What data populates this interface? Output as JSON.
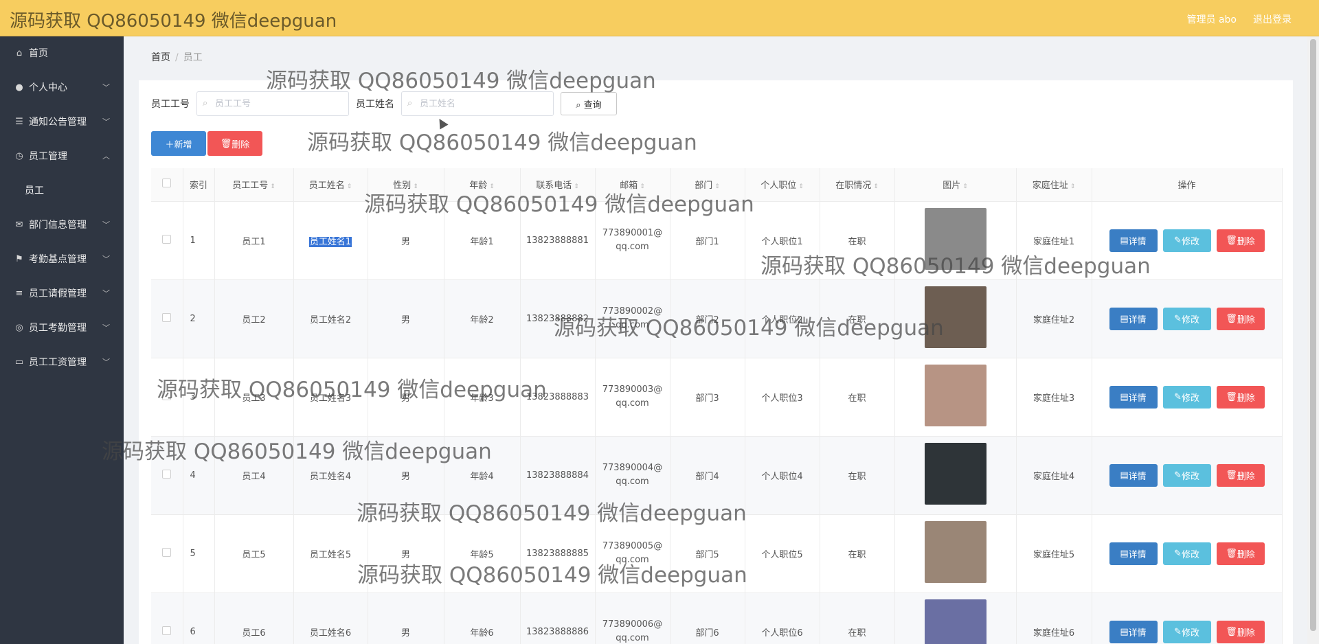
{
  "header": {
    "brand": "源码获取 QQ86050149 微信deepguan",
    "user": "管理员 abo",
    "logout": "退出登录"
  },
  "sidebar": {
    "items": [
      {
        "label": "首页",
        "icon": "home-icon",
        "expandable": false
      },
      {
        "label": "个人中心",
        "icon": "user-icon",
        "expandable": true
      },
      {
        "label": "通知公告管理",
        "icon": "menu-icon",
        "expandable": true
      },
      {
        "label": "员工管理",
        "icon": "clock-icon",
        "expandable": true,
        "expanded": true,
        "children": [
          "员工"
        ]
      },
      {
        "label": "部门信息管理",
        "icon": "mail-icon",
        "expandable": true
      },
      {
        "label": "考勤基点管理",
        "icon": "flag-icon",
        "expandable": true
      },
      {
        "label": "员工请假管理",
        "icon": "sliders-icon",
        "expandable": true
      },
      {
        "label": "员工考勤管理",
        "icon": "circle-icon",
        "expandable": true
      },
      {
        "label": "员工工资管理",
        "icon": "card-icon",
        "expandable": true
      }
    ]
  },
  "breadcrumb": {
    "home": "首页",
    "current": "员工"
  },
  "search": {
    "field1_label": "员工工号",
    "field1_placeholder": "员工工号",
    "field2_label": "员工姓名",
    "field2_placeholder": "员工姓名",
    "query_button": "查询"
  },
  "actions": {
    "add": "新增",
    "delete": "删除"
  },
  "table": {
    "columns": [
      "索引",
      "员工工号",
      "员工姓名",
      "性别",
      "年龄",
      "联系电话",
      "邮箱",
      "部门",
      "个人职位",
      "在职情况",
      "图片",
      "家庭住址",
      "操作"
    ],
    "row_actions": {
      "detail": "详情",
      "edit": "修改",
      "delete": "删除"
    },
    "rows": [
      {
        "index": "1",
        "emp_no": "员工1",
        "name": "员工姓名1",
        "gender": "男",
        "age": "年龄1",
        "phone": "13823888881",
        "email": "773890001@qq.com",
        "dept": "部门1",
        "position": "个人职位1",
        "status": "在职",
        "address": "家庭住址1",
        "photo_color": "#8a8a8a"
      },
      {
        "index": "2",
        "emp_no": "员工2",
        "name": "员工姓名2",
        "gender": "男",
        "age": "年龄2",
        "phone": "13823888882",
        "email": "773890002@qq.com",
        "dept": "部门2",
        "position": "个人职位2",
        "status": "在职",
        "address": "家庭住址2",
        "photo_color": "#6d5e52"
      },
      {
        "index": "3",
        "emp_no": "员工3",
        "name": "员工姓名3",
        "gender": "男",
        "age": "年龄3",
        "phone": "13823888883",
        "email": "773890003@qq.com",
        "dept": "部门3",
        "position": "个人职位3",
        "status": "在职",
        "address": "家庭住址3",
        "photo_color": "#b79484"
      },
      {
        "index": "4",
        "emp_no": "员工4",
        "name": "员工姓名4",
        "gender": "男",
        "age": "年龄4",
        "phone": "13823888884",
        "email": "773890004@qq.com",
        "dept": "部门4",
        "position": "个人职位4",
        "status": "在职",
        "address": "家庭住址4",
        "photo_color": "#2e3438"
      },
      {
        "index": "5",
        "emp_no": "员工5",
        "name": "员工姓名5",
        "gender": "男",
        "age": "年龄5",
        "phone": "13823888885",
        "email": "773890005@qq.com",
        "dept": "部门5",
        "position": "个人职位5",
        "status": "在职",
        "address": "家庭住址5",
        "photo_color": "#9a8676"
      },
      {
        "index": "6",
        "emp_no": "员工6",
        "name": "员工姓名6",
        "gender": "男",
        "age": "年龄6",
        "phone": "13823888886",
        "email": "773890006@qq.com",
        "dept": "部门6",
        "position": "个人职位6",
        "status": "在职",
        "address": "家庭住址6",
        "photo_color": "#6a6fa3"
      }
    ]
  },
  "watermark": "源码获取 QQ86050149 微信deepguan",
  "colors": {
    "header": "#f7cd5f",
    "sidebar": "#2f3642",
    "primary": "#3e87d4",
    "danger": "#f25656",
    "info": "#5bc0de"
  }
}
